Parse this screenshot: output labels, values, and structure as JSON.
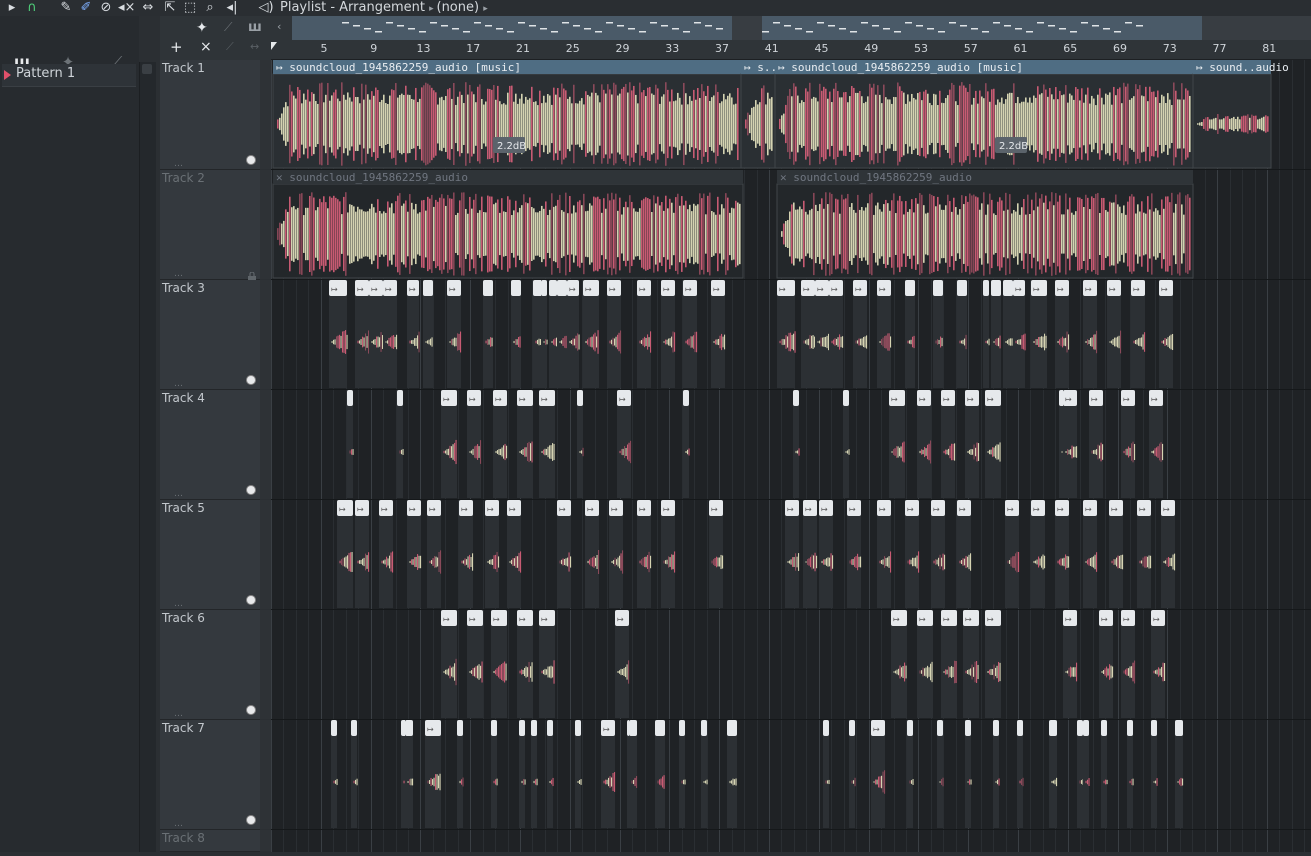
{
  "toolbar": {
    "title_playlist": "Playlist - Arrangement",
    "title_pattern": "(none)",
    "icons": [
      "play-arrow-icon",
      "magnet-icon",
      "pencil-icon",
      "brush-icon",
      "delete-icon",
      "mute-icon",
      "slip-icon",
      "select-icon",
      "zoom-icon",
      "playback-icon",
      "speaker-icon"
    ]
  },
  "browser": {
    "tabs": [
      "piano-roll-icon",
      "audio-wave-icon",
      "automation-icon"
    ],
    "patterns": [
      {
        "label": "Pattern 1"
      }
    ]
  },
  "header_tools": {
    "add": "+",
    "delete": "×"
  },
  "ruler": {
    "bars": [
      "5",
      "9",
      "13",
      "17",
      "21",
      "25",
      "29",
      "33",
      "37",
      "41",
      "45",
      "49",
      "53",
      "57",
      "61",
      "65",
      "69",
      "73",
      "77",
      "81"
    ]
  },
  "tracks": [
    {
      "name": "Track 1",
      "dim": false,
      "lock": false
    },
    {
      "name": "Track 2",
      "dim": true,
      "lock": true
    },
    {
      "name": "Track 3",
      "dim": false,
      "lock": false
    },
    {
      "name": "Track 4",
      "dim": false,
      "lock": false
    },
    {
      "name": "Track 5",
      "dim": false,
      "lock": false
    },
    {
      "name": "Track 6",
      "dim": false,
      "lock": false
    },
    {
      "name": "Track 7",
      "dim": false,
      "lock": false
    },
    {
      "name": "Track 8",
      "dim": true,
      "lock": false
    }
  ],
  "clips": {
    "track1": [
      {
        "label": "soundcloud_1945862259_audio [music]",
        "gain": "2.2dB"
      },
      {
        "label": "s..io",
        "gain": ""
      },
      {
        "label": "soundcloud_1945862259_audio [music]",
        "gain": "2.2dB"
      },
      {
        "label": "sound..audio",
        "gain": ""
      }
    ],
    "track2": [
      {
        "label": "soundcloud_1945862259_audio"
      },
      {
        "label": "soundcloud_1945862259_audio"
      }
    ]
  },
  "colors": {
    "wave_red": "#d9607a",
    "wave_cream": "#e8e6c0",
    "clip_header_active": "#4f6d83",
    "clip_header_muted": "#2f3438",
    "track_header": "#34393e",
    "grid_bg": "#1f2225"
  }
}
